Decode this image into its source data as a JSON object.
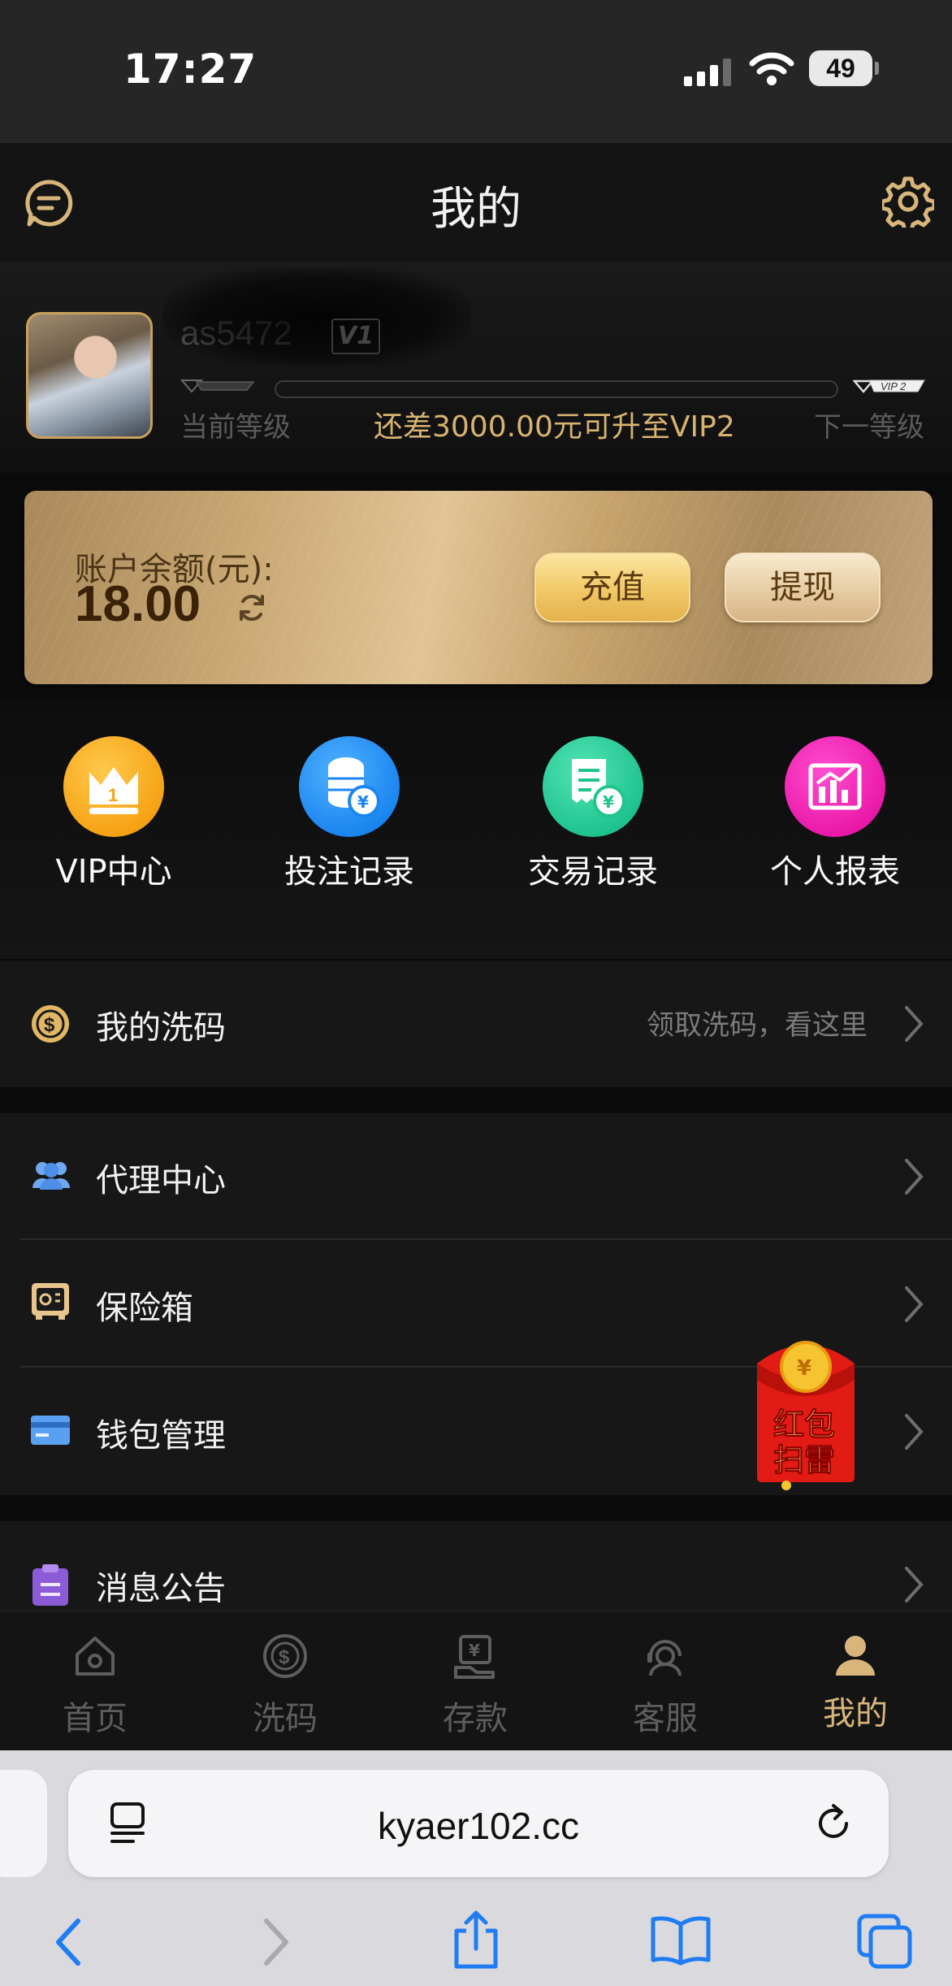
{
  "status_bar": {
    "time": "17:27",
    "battery": "49"
  },
  "header": {
    "title": "我的"
  },
  "profile": {
    "username": "as5472",
    "vip_badge": "V1",
    "current_level_label": "当前等级",
    "next_level_label": "下一等级",
    "next_level_badge": "VIP 2",
    "upgrade_hint": "还差3000.00元可升至VIP2",
    "level_progress": 0
  },
  "balance": {
    "label": "账户余额(元):",
    "amount": "18.00",
    "recharge": "充值",
    "withdraw": "提现"
  },
  "quick_actions": [
    {
      "label": "VIP中心",
      "icon": "crown-icon",
      "color": "#f6a315"
    },
    {
      "label": "投注记录",
      "icon": "coins-icon",
      "color": "#1c86f0"
    },
    {
      "label": "交易记录",
      "icon": "receipt-icon",
      "color": "#1fc48f"
    },
    {
      "label": "个人报表",
      "icon": "chart-icon",
      "color": "#ea1aa9"
    }
  ],
  "menu": {
    "wash": {
      "label": "我的洗码",
      "hint": "领取洗码，看这里"
    },
    "agent": {
      "label": "代理中心"
    },
    "safe": {
      "label": "保险箱"
    },
    "wallet": {
      "label": "钱包管理"
    },
    "notice": {
      "label": "消息公告"
    }
  },
  "red_packet": {
    "line1": "红包",
    "line2": "扫雷"
  },
  "tab_bar": [
    {
      "label": "首页",
      "icon": "home-icon"
    },
    {
      "label": "洗码",
      "icon": "dollar-coin-icon"
    },
    {
      "label": "存款",
      "icon": "deposit-icon"
    },
    {
      "label": "客服",
      "icon": "support-icon"
    },
    {
      "label": "我的",
      "icon": "user-icon",
      "active": true
    }
  ],
  "browser": {
    "url": "kyaer102.cc"
  },
  "colors": {
    "accent_gold": "#d8b67b",
    "background": "#0b0b0c",
    "card_gold": "#c9a874"
  }
}
